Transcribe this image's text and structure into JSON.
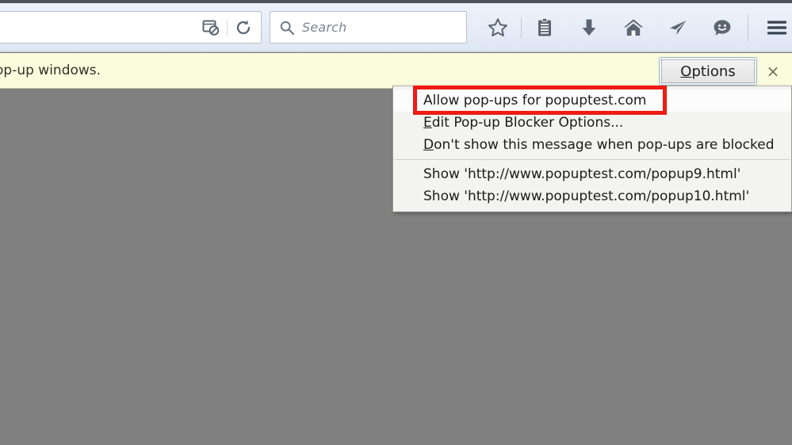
{
  "browser": {
    "urlbar": {
      "value": "",
      "placeholder": "",
      "buttons": [
        {
          "name": "popup-blocked-icon",
          "label": "Pop-up blocked"
        },
        {
          "name": "reload-icon",
          "label": "Reload"
        }
      ]
    },
    "search": {
      "placeholder": "Search",
      "value": "",
      "icon": "search-icon"
    },
    "toolbar_icons": [
      {
        "name": "star-icon",
        "label": "Bookmark this page"
      },
      {
        "name": "library-icon",
        "label": "Show your bookmarks"
      },
      {
        "name": "download-icon",
        "label": "Downloads"
      },
      {
        "name": "home-icon",
        "label": "Home"
      },
      {
        "name": "send-tab-icon",
        "label": "Send tab"
      },
      {
        "name": "hello-icon",
        "label": "Firefox Hello"
      },
      {
        "name": "hamburger-menu-icon",
        "label": "Open menu"
      }
    ]
  },
  "notification": {
    "message": "op-up windows.",
    "options_label_accel": "O",
    "options_label_rest": "ptions",
    "close_glyph": "×",
    "background_color": "#fbfbdd"
  },
  "popup_menu": {
    "items": [
      {
        "name": "menu-item-allow-popups",
        "accel": "",
        "text": "Allow pop-ups for popuptest.com",
        "highlighted": true,
        "annotated": true
      },
      {
        "name": "menu-item-edit-popup-blocker-options",
        "accel": "E",
        "text": "dit Pop-up Blocker Options...",
        "highlighted": false,
        "annotated": false
      },
      {
        "name": "menu-item-dont-show-message",
        "accel": "D",
        "text": "on't show this message when pop-ups are blocked",
        "highlighted": false,
        "annotated": false
      },
      {
        "name": "menu-item-show-popup9",
        "accel": "",
        "text": "Show 'http://www.popuptest.com/popup9.html'",
        "highlighted": false,
        "annotated": false
      },
      {
        "name": "menu-item-show-popup10",
        "accel": "",
        "text": "Show 'http://www.popuptest.com/popup10.html'",
        "highlighted": false,
        "annotated": false
      }
    ]
  },
  "annotation": {
    "color": "#ee1c12",
    "target": "Allow pop-ups for popuptest.com"
  },
  "page": {
    "background_color": "#808080"
  }
}
